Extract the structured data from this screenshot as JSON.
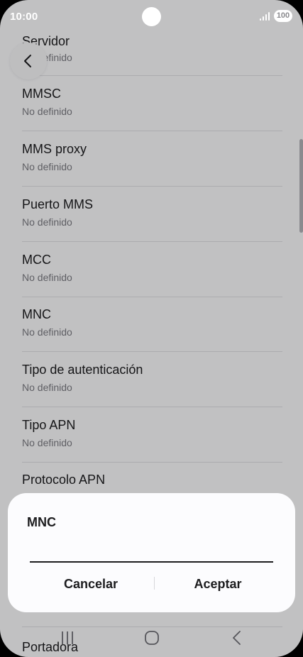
{
  "status_bar": {
    "time": "10:00",
    "battery": "100",
    "icons": [
      "signal-icon",
      "battery-icon"
    ]
  },
  "list": {
    "items": [
      {
        "title": "Servidor",
        "value": "No definido"
      },
      {
        "title": "MMSC",
        "value": "No definido"
      },
      {
        "title": "MMS proxy",
        "value": "No definido"
      },
      {
        "title": "Puerto MMS",
        "value": "No definido"
      },
      {
        "title": "MCC",
        "value": "No definido"
      },
      {
        "title": "MNC",
        "value": "No definido"
      },
      {
        "title": "Tipo de autenticación",
        "value": "No definido"
      },
      {
        "title": "Tipo APN",
        "value": "No definido"
      },
      {
        "title": "Protocolo APN",
        "value": ""
      },
      {
        "title": "",
        "value": ""
      },
      {
        "title": "Portadora",
        "value": ""
      }
    ]
  },
  "navigation": {
    "back_icon": "chevron-left-icon",
    "nav_icons": [
      "recent-apps-icon",
      "home-icon",
      "back-icon"
    ]
  },
  "dialog": {
    "title": "MNC",
    "input_value": "",
    "cancel_label": "Cancelar",
    "accept_label": "Aceptar"
  },
  "colors": {
    "background": "#f6f6f8",
    "text_primary": "#1c1c1e",
    "text_secondary": "#7a7a80",
    "divider": "#dcdce0"
  }
}
